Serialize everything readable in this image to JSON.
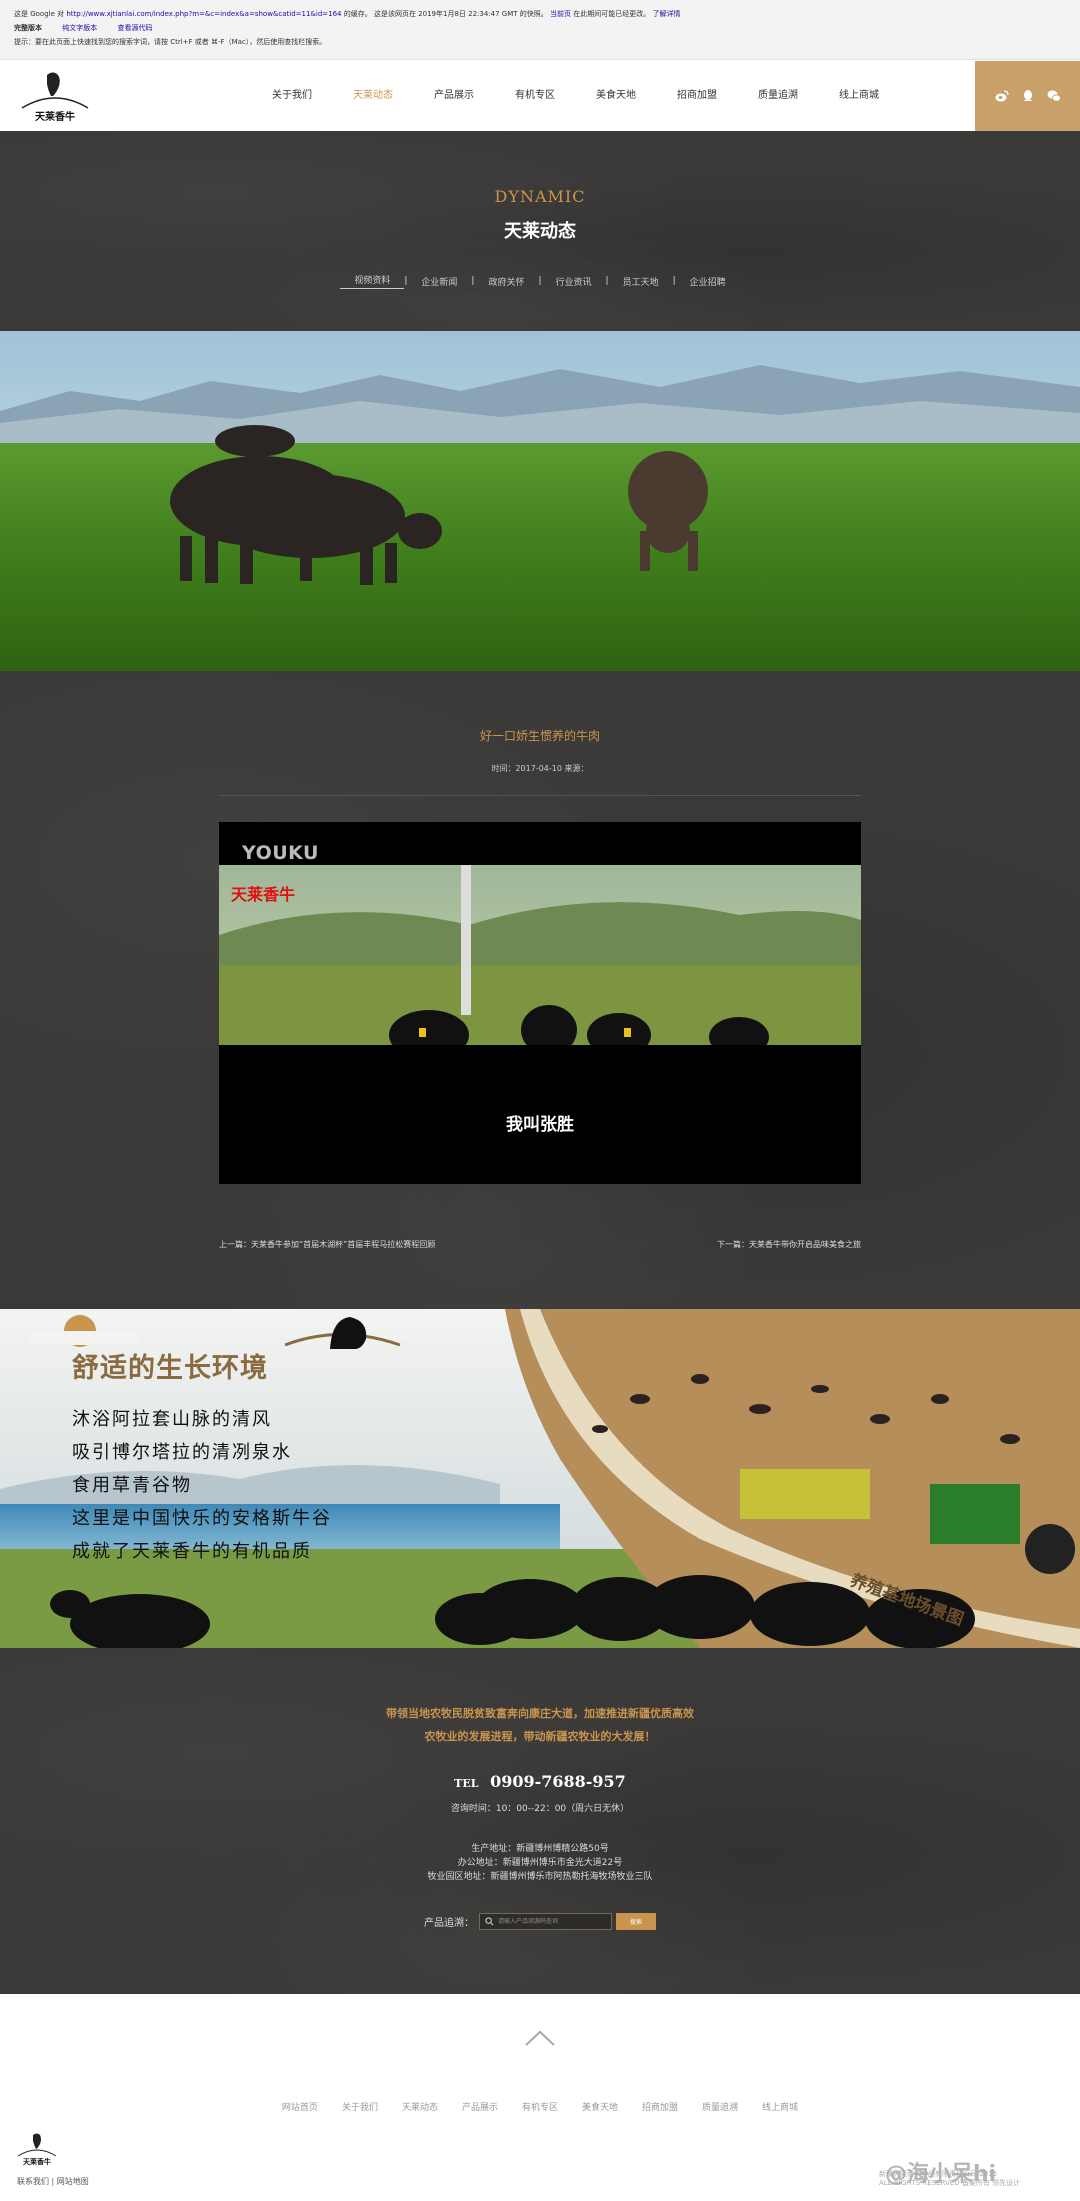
{
  "cache_bar": {
    "line1_prefix": "这是 Google 对",
    "line1_url": "http://www.xjtianlai.com/index.php?m=&c=index&a=show&catid=11&id=164",
    "line1_mid": "的缓存。 这是该网页在 2019年1月8日 22:34:47 GMT 的快照。",
    "line1_link1": "当前页",
    "line1_mid2": "在此期间可能已经更改。",
    "line1_link2": "了解详情",
    "line2_label": "完整版本",
    "line2_link1": "纯文字版本",
    "line2_link2": "查看源代码",
    "line3": "提示：要在此页面上快速找到您的搜索字词，请按 Ctrl+F 或者 ⌘-F（Mac），然后使用查找栏搜索。"
  },
  "nav": {
    "items": [
      "关于我们",
      "天莱动态",
      "产品展示",
      "有机专区",
      "美食天地",
      "招商加盟",
      "质量追溯",
      "线上商城"
    ],
    "active_index": 1
  },
  "logo": {
    "text": "天莱香牛"
  },
  "social_icons": [
    "weibo-icon",
    "qq-icon",
    "wechat-icon"
  ],
  "banner": {
    "en_title": "DYNAMIC",
    "cn_title": "天莱动态",
    "subnav": [
      "视频资料",
      "企业新闻",
      "政府关怀",
      "行业资讯",
      "员工天地",
      "企业招聘"
    ],
    "active_subnav": 0
  },
  "article": {
    "title": "好一口娇生惯养的牛肉",
    "meta": "时间：2017-04-10 来源：",
    "video_brand": "YOUKU",
    "video_logo": "天莱香牛",
    "video_subtitle": "我叫张胜",
    "prev": "上一篇：天莱香牛参加“首届木湖杯”首届丰程马拉松赛程回顾",
    "next": "下一篇：天莱香牛带你开启品味美食之旅"
  },
  "env_banner": {
    "title": "舒适的生长环境",
    "lines": [
      "沐浴阿拉套山脉的清风",
      "吸引博尔塔拉的清冽泉水",
      "食用草青谷物",
      "这里是中国快乐的安格斯牛谷",
      "成就了天莱香牛的有机品质"
    ],
    "stamp": "养殖基地场景图"
  },
  "contact": {
    "slogan_line1": "带领当地农牧民脱贫致富奔向康庄大道，加速推进新疆优质高效",
    "slogan_line2": "农牧业的发展进程，带动新疆农牧业的大发展！",
    "tel_label": "TEL",
    "tel_number": "0909-7688-957",
    "hours": "咨询时间：10：00--22：00（周六日无休）",
    "addr1": "生产地址：新疆博州博精公路50号",
    "addr2": "办公地址：新疆博州博乐市金光大道22号",
    "addr3": "牧业园区地址：新疆博州博乐市阿热勒托海牧场牧业三队",
    "search_label": "产品追溯：",
    "search_placeholder": "请输入产品溯源码查询",
    "search_button": "搜索"
  },
  "footer": {
    "nav": [
      "网站首页",
      "关于我们",
      "天莱动态",
      "产品展示",
      "有机专区",
      "美食天地",
      "招商加盟",
      "质量追溯",
      "线上商城"
    ],
    "links": "联系我们 | 网站地图",
    "copyright1": "新疆天莱香牛食品有限责任公司 2015",
    "copyright2": "ALL RIGHTS RESERVED 备案所有 领先设计",
    "watermark": "@海小呆hi"
  },
  "colors": {
    "accent": "#c9944e",
    "dark_bg": "#3a3937",
    "social_bg": "#c9a069"
  }
}
